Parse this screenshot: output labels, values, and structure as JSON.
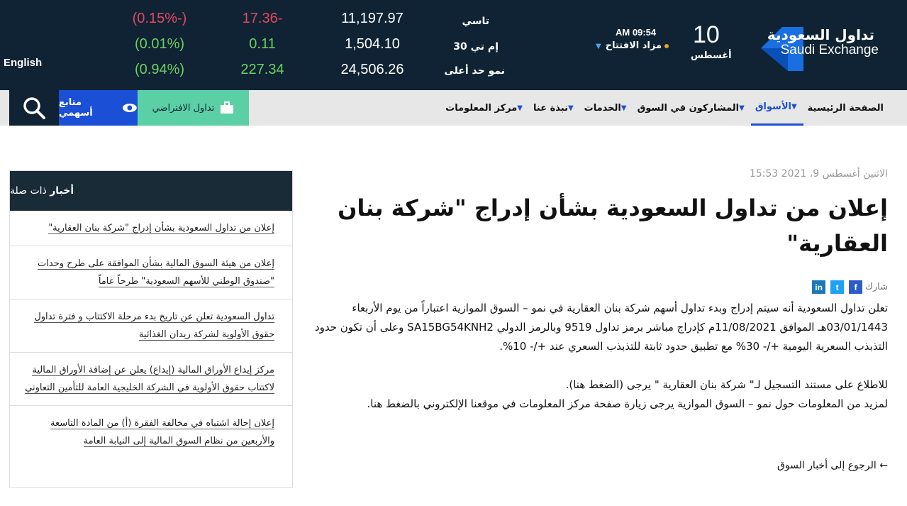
{
  "header": {
    "language_link": "English",
    "logo_ar": "تداول السعودية",
    "logo_en": "Saudi Exchange",
    "day": "10",
    "month": "أغسطس",
    "time": "AM 09:54",
    "market_status": "مزاد الافتتاح",
    "tickers": [
      {
        "name": "تاسي",
        "value": "11,197.97",
        "change": "17.36-",
        "percent": "(0.15%-)",
        "direction": "down"
      },
      {
        "name": "إم تي 30",
        "value": "1,504.10",
        "change": "0.11",
        "percent": "(0.01%)",
        "direction": "up"
      },
      {
        "name": "نمو حد أعلى",
        "value": "24,506.26",
        "change": "227.34",
        "percent": "(0.94%)",
        "direction": "up"
      }
    ]
  },
  "nav": {
    "items": [
      {
        "label": "الصفحة الرئيسية",
        "chevron": false,
        "active": false
      },
      {
        "label": "الأسواق",
        "chevron": true,
        "active": true
      },
      {
        "label": "المشاركون في السوق",
        "chevron": true,
        "active": false
      },
      {
        "label": "الخدمات",
        "chevron": true,
        "active": false
      },
      {
        "label": "نبذة عنا",
        "chevron": true,
        "active": false
      },
      {
        "label": "مركز المعلومات",
        "chevron": true,
        "active": false
      }
    ],
    "virtual_trading": "تداول الافتراضي",
    "watchlist": "متابع أسهمي"
  },
  "article": {
    "date": "الاثنين أغسطس 9، 2021 15:53",
    "title": "إعلان من تداول السعودية بشأن إدراج \"شركة بنان العقارية\"",
    "share_label": "شارك",
    "paragraph1": "تعلن تداول السعودية أنه سيتم إدراج وبدء تداول أسهم شركة بنان العقارية في نمو – السوق الموازية اعتباراً من يوم الأربعاء 03/01/1443هـ الموافق 11/08/2021م كإدراج مباشر برمز تداول 9519 وبالرمز الدولي SA15BG54KNH2 وعلى أن تكون حدود التذبذب السعرية اليومية +/- 30% مع تطبيق حدود ثابتة للتذبذب السعري عند +/- 10%.",
    "paragraph2": "للاطلاع على مستند التسجيل لـ\" شركة بنان العقارية \" يرجى (الضغط هنا).",
    "paragraph3": "لمزيد من المعلومات حول نمو – السوق الموازية يرجى زيارة صفحة مركز المعلومات في موقعنا الإلكتروني بالضغط هنا.",
    "back_link": "← الرجوع إلى أخبار السوق"
  },
  "related": {
    "heading_bold": "أخبار",
    "heading_rest": "ذات صلة",
    "items": [
      "إعلان من تداول السعودية بشأن إدراج \"شركة بنان العقارية\"",
      "إعلان من هيئة السوق المالية بشأن الموافقة على طرح وحدات \"صندوق الوطني للأسهم السعودية\" طرحاً عاماً",
      "تداول السعودية تعلن عن تاريخ بدء مرحلة الاكتتاب و فترة تداول حقوق الأولوية لشركة ريدان الغذائية",
      "مركز إيداع الأوراق المالية (إيداع) يعلن عن إضافة الأوراق المالية لاكتتاب حقوق الأولوية في الشركة الخليجية العامة للتأمين التعاوني",
      "إعلان إحالة اشتباه في مخالفة الفقرة (أ) من المادة التاسعة والأربعين من نظام السوق المالية إلى النيابة العامة"
    ]
  },
  "colors": {
    "header_bg": "#0f2334",
    "accent_blue": "#1a4fd6",
    "green_button": "#5bd0a6",
    "negative": "#e0495c",
    "positive": "#6fcf62"
  }
}
